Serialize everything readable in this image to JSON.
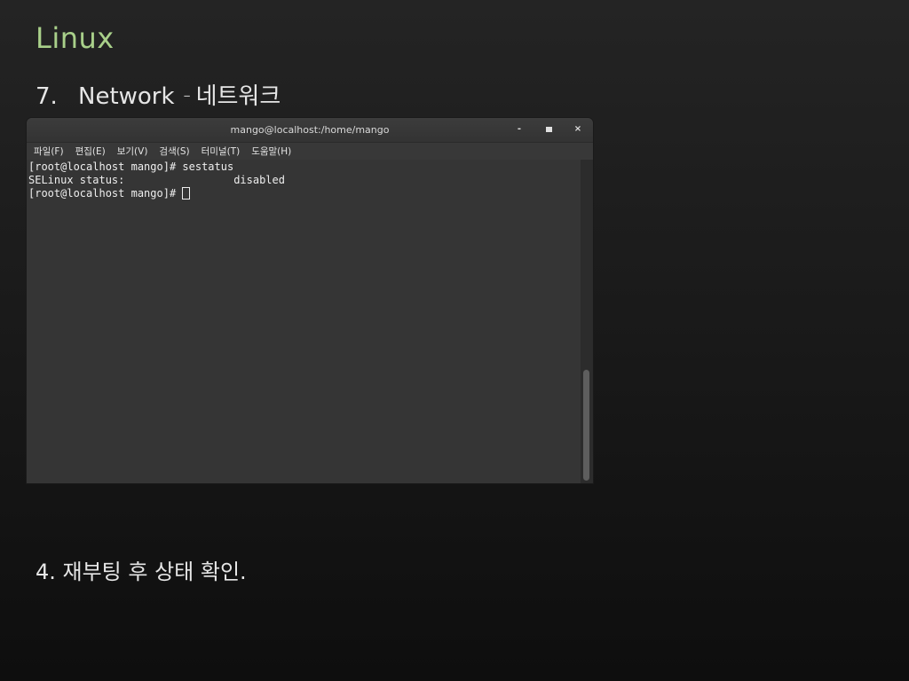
{
  "slide": {
    "title": "Linux",
    "subtitle_number": "7.",
    "subtitle_text": "Network",
    "subtitle_dash": "–",
    "subtitle_korean": "네트워크",
    "caption": "4. 재부팅 후 상태 확인."
  },
  "terminal": {
    "window_title": "mango@localhost:/home/mango",
    "buttons": {
      "minimize": "-",
      "close": "×"
    },
    "menu": [
      {
        "label": "파일(F)"
      },
      {
        "label": "편집(E)"
      },
      {
        "label": "보기(V)"
      },
      {
        "label": "검색(S)"
      },
      {
        "label": "터미널(T)"
      },
      {
        "label": "도움말(H)"
      }
    ],
    "lines": [
      {
        "text": "[root@localhost mango]# sestatus"
      },
      {
        "text": "SELinux status:                 disabled"
      },
      {
        "text": "[root@localhost mango]# "
      }
    ]
  },
  "colors": {
    "title_accent": "#a9d08a",
    "terminal_bg": "#353535",
    "slide_bg": "#1a1a1a"
  }
}
